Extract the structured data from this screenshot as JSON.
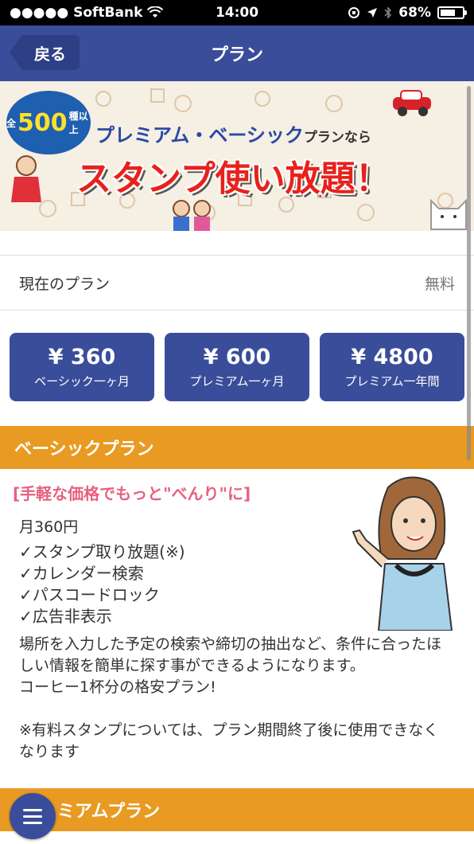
{
  "status_bar": {
    "carrier": "●●●●● SoftBank",
    "time": "14:00",
    "battery_percent": "68%",
    "battery_level": 0.68,
    "icons": [
      "wifi-icon",
      "orientation-lock-icon",
      "location-icon",
      "bluetooth-icon",
      "battery-icon"
    ]
  },
  "nav": {
    "back_label": "戻る",
    "title": "プラン"
  },
  "banner": {
    "badge_prefix": "全",
    "badge_number": "500",
    "badge_suffix": "種以上",
    "headline": "プレミアム・ベーシック",
    "headline_suffix": "プランなら",
    "bigline": "スタンプ使い放題！"
  },
  "current_plan": {
    "label": "現在のプラン",
    "value": "無料"
  },
  "prices": [
    {
      "price": "¥ 360",
      "label": "ベーシック一ヶ月"
    },
    {
      "price": "¥ 600",
      "label": "プレミアム一ヶ月"
    },
    {
      "price": "¥ 4800",
      "label": "プレミアム一年間"
    }
  ],
  "basic_plan": {
    "header": "ベーシックプラン",
    "catch": "[手軽な価格でもっと\"べんり\"に]",
    "price_line": "月360円",
    "features": [
      "✓スタンプ取り放題(※)",
      "✓カレンダー検索",
      "✓パスコードロック",
      "✓広告非表示"
    ],
    "description": "場所を入力した予定の検索や締切の抽出など、条件に合ったほしい情報を簡単に探す事ができるようになります。\nコーヒー1杯分の格安プラン!\n\n※有料スタンプについては、プラン期間終了後に使用できなくなります"
  },
  "premium_plan": {
    "header": "ミアムプラン"
  },
  "colors": {
    "nav": "#3a4d9a",
    "section_bar": "#e89a22",
    "catch": "#e8607e"
  }
}
